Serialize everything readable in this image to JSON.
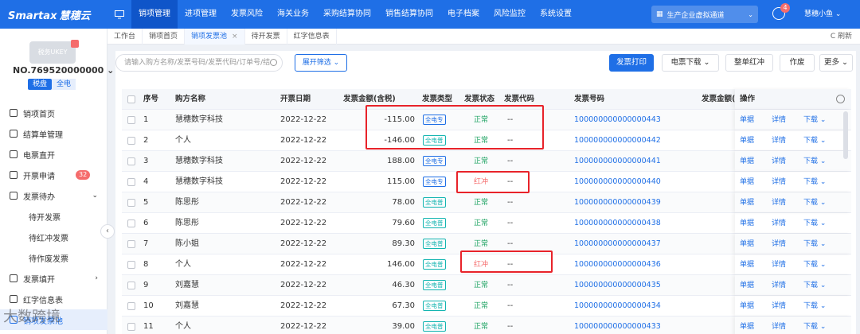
{
  "brand": {
    "logo_text": "Smartax",
    "logo_cn": "慧穗云"
  },
  "nav": [
    {
      "label": "销项管理",
      "active": true
    },
    {
      "label": "进项管理"
    },
    {
      "label": "发票风险"
    },
    {
      "label": "海关业务"
    },
    {
      "label": "采购结算协同"
    },
    {
      "label": "销售结算协同"
    },
    {
      "label": "电子档案"
    },
    {
      "label": "风险监控"
    },
    {
      "label": "系统设置"
    }
  ],
  "channel": "生产企业虚拟通道",
  "notifications": "4",
  "user": "慧穗小鱼",
  "sidebar": {
    "ukey_label": "税务UKEY",
    "tax_no": "NO.769520000000",
    "seg_on": "税盘",
    "seg_off": "全电",
    "items": [
      {
        "label": "销项首页"
      },
      {
        "label": "结算单管理"
      },
      {
        "label": "电票直开"
      },
      {
        "label": "开票申请",
        "badge": "32"
      },
      {
        "label": "发票待办"
      },
      {
        "label": "待开发票"
      },
      {
        "label": "待红冲发票"
      },
      {
        "label": "待作废发票"
      },
      {
        "label": "发票填开"
      },
      {
        "label": "红字信息表"
      },
      {
        "label": "销项发票池"
      }
    ]
  },
  "watermark": "大数跨境",
  "tabs": [
    {
      "label": "工作台"
    },
    {
      "label": "销项首页"
    },
    {
      "label": "销项发票池",
      "active": true
    },
    {
      "label": "待开发票"
    },
    {
      "label": "红字信息表"
    }
  ],
  "refresh": "C 刷新",
  "toolbar": {
    "search_placeholder": "请输入购方名称/发票号码/发票代码/订单号/结",
    "filter": "展开筛选",
    "print": "发票打印",
    "download": "电票下载",
    "whole_red": "整单红冲",
    "void": "作废",
    "more": "更多"
  },
  "table": {
    "headers": {
      "no": "序号",
      "buyer": "购方名称",
      "date": "开票日期",
      "amount": "发票金额(含税)",
      "type": "发票类型",
      "status": "发票状态",
      "code": "发票代码",
      "invno": "发票号码",
      "amount2": "发票金额(",
      "ops": "操作"
    },
    "op_labels": {
      "doc": "单据",
      "detail": "详情",
      "download": "下载"
    },
    "rows": [
      {
        "no": "1",
        "buyer": "慧穗数字科技",
        "date": "2022-12-22",
        "amount": "-115.00",
        "type": "全电专",
        "status": "正常",
        "code": "--",
        "invno": "100000000000000443"
      },
      {
        "no": "2",
        "buyer": "个人",
        "date": "2022-12-22",
        "amount": "-146.00",
        "type": "全电普",
        "status": "正常",
        "code": "--",
        "invno": "100000000000000442"
      },
      {
        "no": "3",
        "buyer": "慧穗数字科技",
        "date": "2022-12-22",
        "amount": "188.00",
        "type": "全电专",
        "status": "正常",
        "code": "--",
        "invno": "100000000000000441"
      },
      {
        "no": "4",
        "buyer": "慧穗数字科技",
        "date": "2022-12-22",
        "amount": "115.00",
        "type": "全电专",
        "status": "红冲",
        "code": "--",
        "invno": "100000000000000440"
      },
      {
        "no": "5",
        "buyer": "陈思彤",
        "date": "2022-12-22",
        "amount": "78.00",
        "type": "全电普",
        "status": "正常",
        "code": "--",
        "invno": "100000000000000439"
      },
      {
        "no": "6",
        "buyer": "陈思彤",
        "date": "2022-12-22",
        "amount": "79.60",
        "type": "全电普",
        "status": "正常",
        "code": "--",
        "invno": "100000000000000438"
      },
      {
        "no": "7",
        "buyer": "陈小姐",
        "date": "2022-12-22",
        "amount": "89.30",
        "type": "全电普",
        "status": "正常",
        "code": "--",
        "invno": "100000000000000437"
      },
      {
        "no": "8",
        "buyer": "个人",
        "date": "2022-12-22",
        "amount": "146.00",
        "type": "全电普",
        "status": "红冲",
        "code": "--",
        "invno": "100000000000000436"
      },
      {
        "no": "9",
        "buyer": "刘嘉慧",
        "date": "2022-12-22",
        "amount": "46.30",
        "type": "全电普",
        "status": "正常",
        "code": "--",
        "invno": "100000000000000435"
      },
      {
        "no": "10",
        "buyer": "刘嘉慧",
        "date": "2022-12-22",
        "amount": "67.30",
        "type": "全电普",
        "status": "正常",
        "code": "--",
        "invno": "100000000000000434"
      },
      {
        "no": "11",
        "buyer": "个人",
        "date": "2022-12-22",
        "amount": "39.00",
        "type": "全电普",
        "status": "正常",
        "code": "--",
        "invno": "100000000000000433"
      }
    ]
  },
  "colors": {
    "brand": "#1f6fe6",
    "highlight": "#e8232a",
    "normal": "#19a15f",
    "red": "#f56c6c"
  }
}
